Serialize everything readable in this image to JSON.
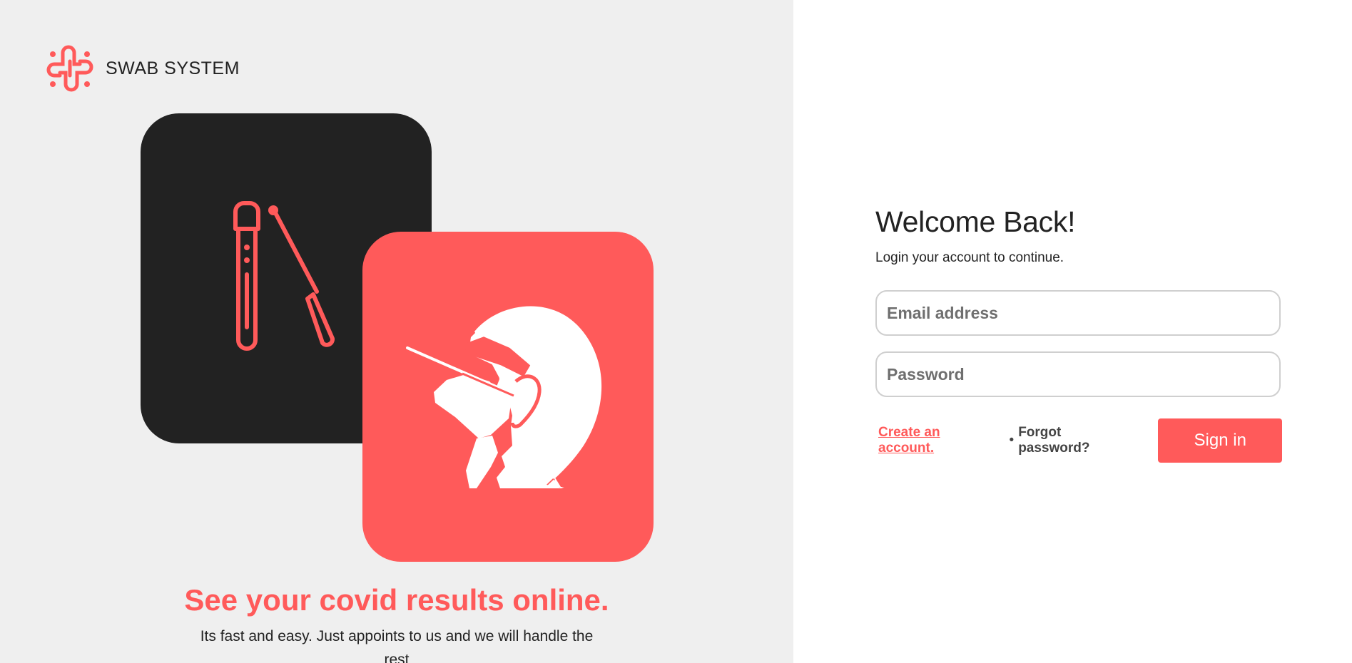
{
  "brand": {
    "name": "SWAB SYSTEM",
    "logo_icon": "medical-cross-icon"
  },
  "hero": {
    "tagline": "See your covid results online.",
    "subtext": "Its fast and easy. Just appoints to us and we will handle the rest"
  },
  "login": {
    "title": "Welcome Back!",
    "subtitle": "Login your account to continue.",
    "email_placeholder": "Email address",
    "email_value": "",
    "password_placeholder": "Password",
    "password_value": "",
    "create_account_label": "Create an account.",
    "separator": "•",
    "forgot_label": "Forgot password?",
    "signin_label": "Sign in"
  },
  "colors": {
    "accent": "#ff5a5a",
    "dark": "#222222",
    "panel": "#efefef"
  },
  "illustrations": {
    "dark_card": "test-tube-and-swab-icon",
    "red_card": "nasal-swab-test-icon"
  }
}
